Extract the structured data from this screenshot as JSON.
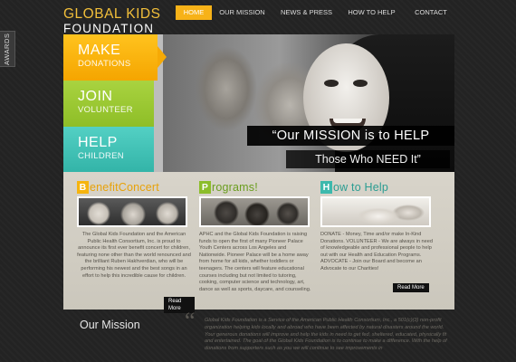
{
  "awards_tab": "AWARDS",
  "logo": {
    "line1": "GLOBAL KIDS",
    "line2": "FOUNDATION"
  },
  "nav": {
    "items": [
      "HOME",
      "OUR MISSION",
      "NEWS & PRESS",
      "HOW TO HELP",
      "CONTACT"
    ],
    "active": "HOME"
  },
  "hero": {
    "tiles": [
      {
        "title": "MAKE",
        "subtitle": "DONATIONS",
        "color": "#f6b40e"
      },
      {
        "title": "JOIN",
        "subtitle": "VOLUNTEER",
        "color": "#8cbd2a"
      },
      {
        "title": "HELP",
        "subtitle": "CHILDREN",
        "color": "#3db9ad"
      }
    ],
    "mission_line1": "“Our MISSION is to HELP",
    "mission_line2": "Those Who NEED It”"
  },
  "columns": [
    {
      "cap": "B",
      "rest": "enefitConcert",
      "text": "The Global Kids Foundation and the American Public Health Consortium, Inc. is proud to announce its first ever benefit concert for children, featuring none other than the world renounced and the brilliant Ruben Hakhverdian, who will be performing his newest and the best songs in an effort to help this incredible cause for children.",
      "link": "Read More"
    },
    {
      "cap": "P",
      "rest": "rograms!",
      "text": "APHC and the Global Kids Foundation is raising funds to open the first of many Pioneer Palace Youth Centers across Los Angeles and Nationwide. Pioneer Palace will be a home away from home for all kids, whether toddlers or teenagers. The centers will feature educational courses including but not limited to tutoring, cooking, computer science and technology, art, dance as well as sports, daycare, and counseling."
    },
    {
      "cap": "H",
      "rest": "ow to Help",
      "text": "DONATE - Money, Time and/or make In-Kind Donations. VOLUNTEER - We are always in need of knowledgeable and professional people to help out with our Health and Education Programs. ADVOCATE - Join our Board and become an Advocate to our Charities!",
      "link": "Read More"
    }
  ],
  "mission": {
    "heading": "Our Mission",
    "quote_mark": "“",
    "text": "Global Kids Foundation is a Service of the American Public Health Consortium, Inc., a 501(c)(3) non-profit organization helping kids locally and abroad who have been affected by natural disasters around the world. Your generous donations will improve and help the kids in need to get fed, sheltered, educated, physically fit and entertained. The goal of the Global Kids Foundation is to continue to make a difference. With the help of donations from supporters such as you we will continue to see improvements in"
  }
}
